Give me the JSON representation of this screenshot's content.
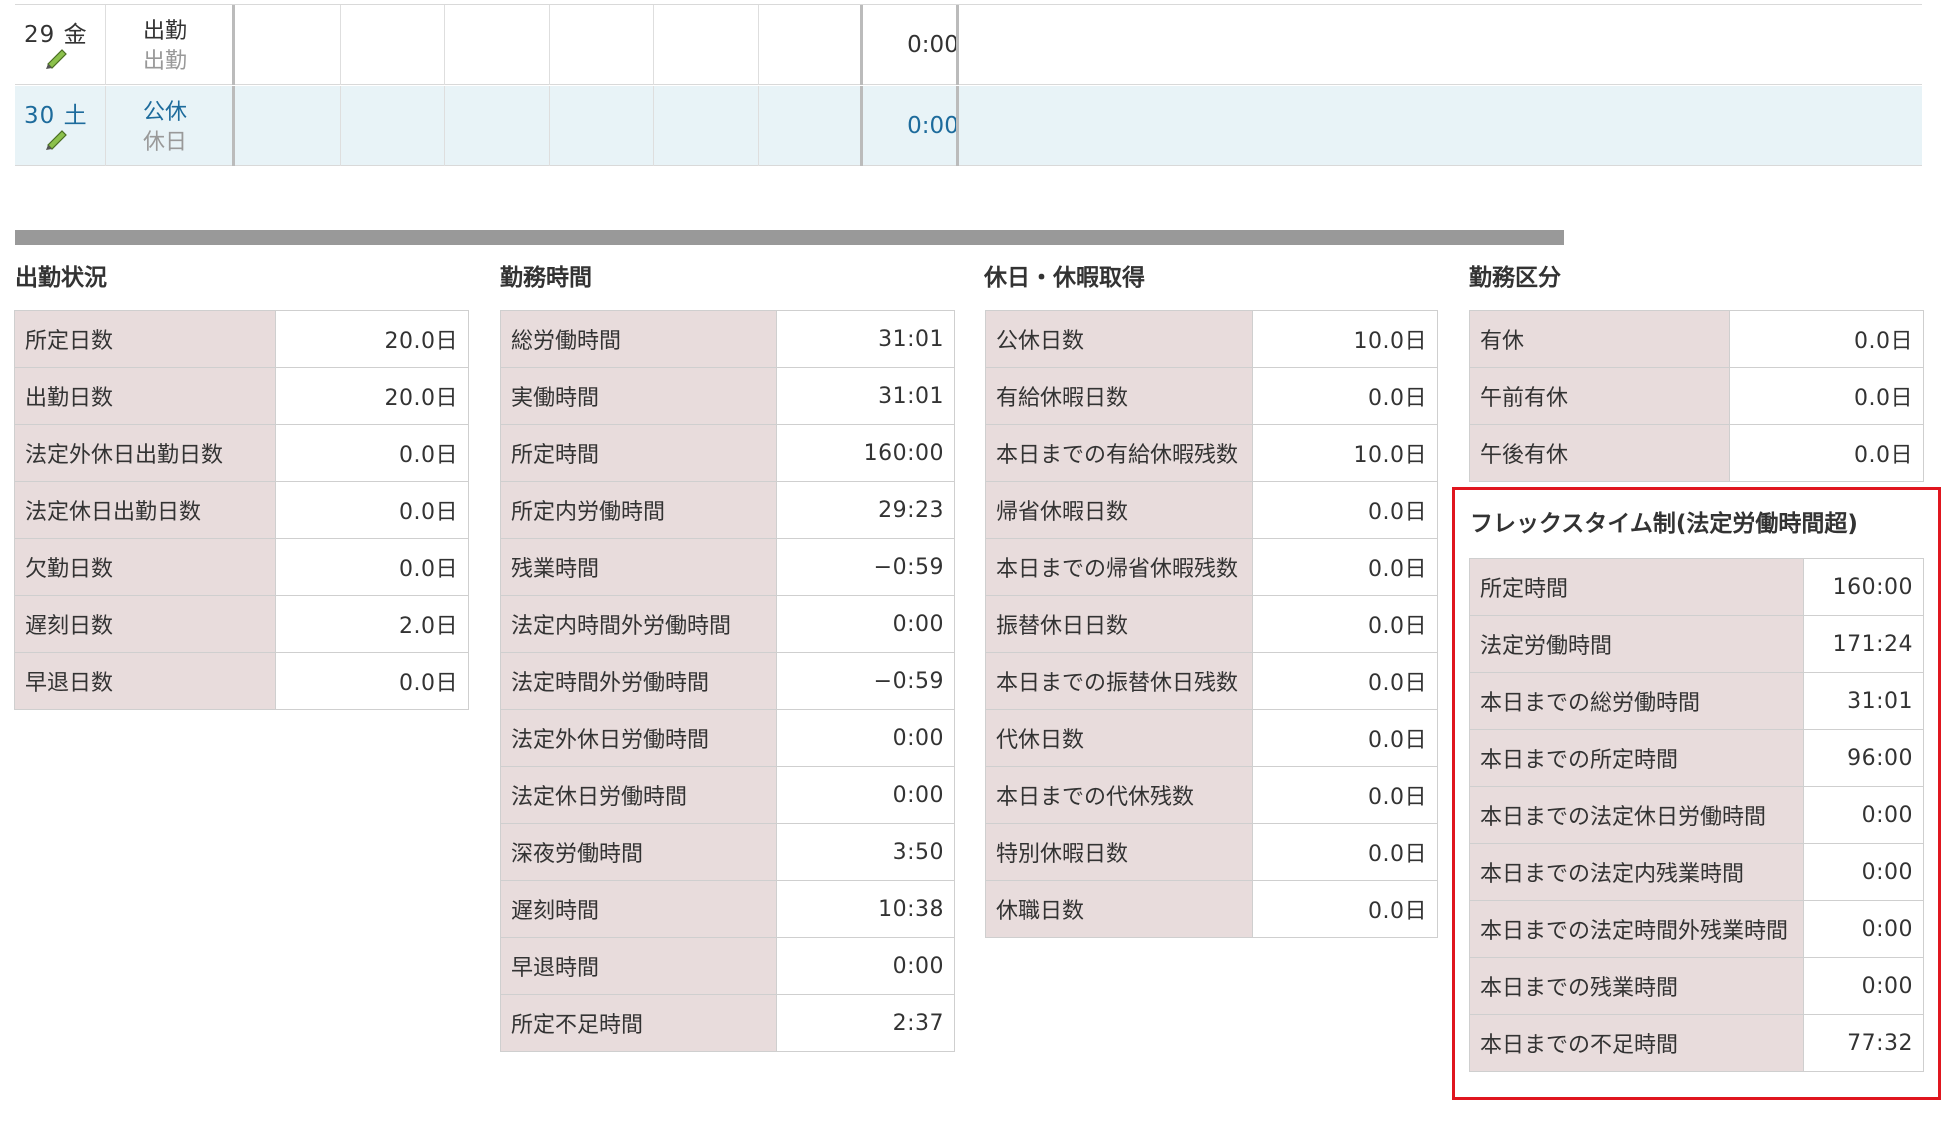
{
  "calendar_rows": [
    {
      "day": "29",
      "weekday": "金",
      "status": "出勤",
      "sub_status": "出勤",
      "hours": "0:00"
    },
    {
      "day": "30",
      "weekday": "土",
      "status": "公休",
      "sub_status": "休日",
      "hours": "0:00"
    }
  ],
  "sections": {
    "attendance": {
      "title": "出勤状況",
      "rows": [
        {
          "label": "所定日数",
          "value": "20.0日"
        },
        {
          "label": "出勤日数",
          "value": "20.0日"
        },
        {
          "label": "法定外休日出勤日数",
          "value": "0.0日"
        },
        {
          "label": "法定休日出勤日数",
          "value": "0.0日"
        },
        {
          "label": "欠勤日数",
          "value": "0.0日"
        },
        {
          "label": "遅刻日数",
          "value": "2.0日"
        },
        {
          "label": "早退日数",
          "value": "0.0日"
        }
      ]
    },
    "work_hours": {
      "title": "勤務時間",
      "rows": [
        {
          "label": "総労働時間",
          "value": "31:01"
        },
        {
          "label": "実働時間",
          "value": "31:01"
        },
        {
          "label": "所定時間",
          "value": "160:00"
        },
        {
          "label": "所定内労働時間",
          "value": "29:23"
        },
        {
          "label": "残業時間",
          "value": "−0:59"
        },
        {
          "label": "法定内時間外労働時間",
          "value": "0:00"
        },
        {
          "label": "法定時間外労働時間",
          "value": "−0:59"
        },
        {
          "label": "法定外休日労働時間",
          "value": "0:00"
        },
        {
          "label": "法定休日労働時間",
          "value": "0:00"
        },
        {
          "label": "深夜労働時間",
          "value": "3:50"
        },
        {
          "label": "遅刻時間",
          "value": "10:38"
        },
        {
          "label": "早退時間",
          "value": "0:00"
        },
        {
          "label": "所定不足時間",
          "value": "2:37"
        }
      ]
    },
    "holidays": {
      "title": "休日・休暇取得",
      "rows": [
        {
          "label": "公休日数",
          "value": "10.0日"
        },
        {
          "label": "有給休暇日数",
          "value": "0.0日"
        },
        {
          "label": "本日までの有給休暇残数",
          "value": "10.0日"
        },
        {
          "label": "帰省休暇日数",
          "value": "0.0日"
        },
        {
          "label": "本日までの帰省休暇残数",
          "value": "0.0日"
        },
        {
          "label": "振替休日日数",
          "value": "0.0日"
        },
        {
          "label": "本日までの振替休日残数",
          "value": "0.0日"
        },
        {
          "label": "代休日数",
          "value": "0.0日"
        },
        {
          "label": "本日までの代休残数",
          "value": "0.0日"
        },
        {
          "label": "特別休暇日数",
          "value": "0.0日"
        },
        {
          "label": "休職日数",
          "value": "0.0日"
        }
      ]
    },
    "work_category": {
      "title": "勤務区分",
      "rows": [
        {
          "label": "有休",
          "value": "0.0日"
        },
        {
          "label": "午前有休",
          "value": "0.0日"
        },
        {
          "label": "午後有休",
          "value": "0.0日"
        }
      ]
    },
    "flex": {
      "title": "フレックスタイム制(法定労働時間超)",
      "rows": [
        {
          "label": "所定時間",
          "value": "160:00"
        },
        {
          "label": "法定労働時間",
          "value": "171:24"
        },
        {
          "label": "本日までの総労働時間",
          "value": "31:01"
        },
        {
          "label": "本日までの所定時間",
          "value": "96:00"
        },
        {
          "label": "本日までの法定休日労働時間",
          "value": "0:00"
        },
        {
          "label": "本日までの法定内残業時間",
          "value": "0:00"
        },
        {
          "label": "本日までの法定時間外残業時間",
          "value": "0:00"
        },
        {
          "label": "本日までの残業時間",
          "value": "0:00"
        },
        {
          "label": "本日までの不足時間",
          "value": "77:32"
        }
      ]
    }
  },
  "colors": {
    "label_bg": "#e8dcdc",
    "holiday_row_bg": "#e8f3f7",
    "holiday_text": "#1d6b9c",
    "highlight_border": "#e0161f"
  },
  "icons": {
    "edit": "pencil-icon"
  }
}
